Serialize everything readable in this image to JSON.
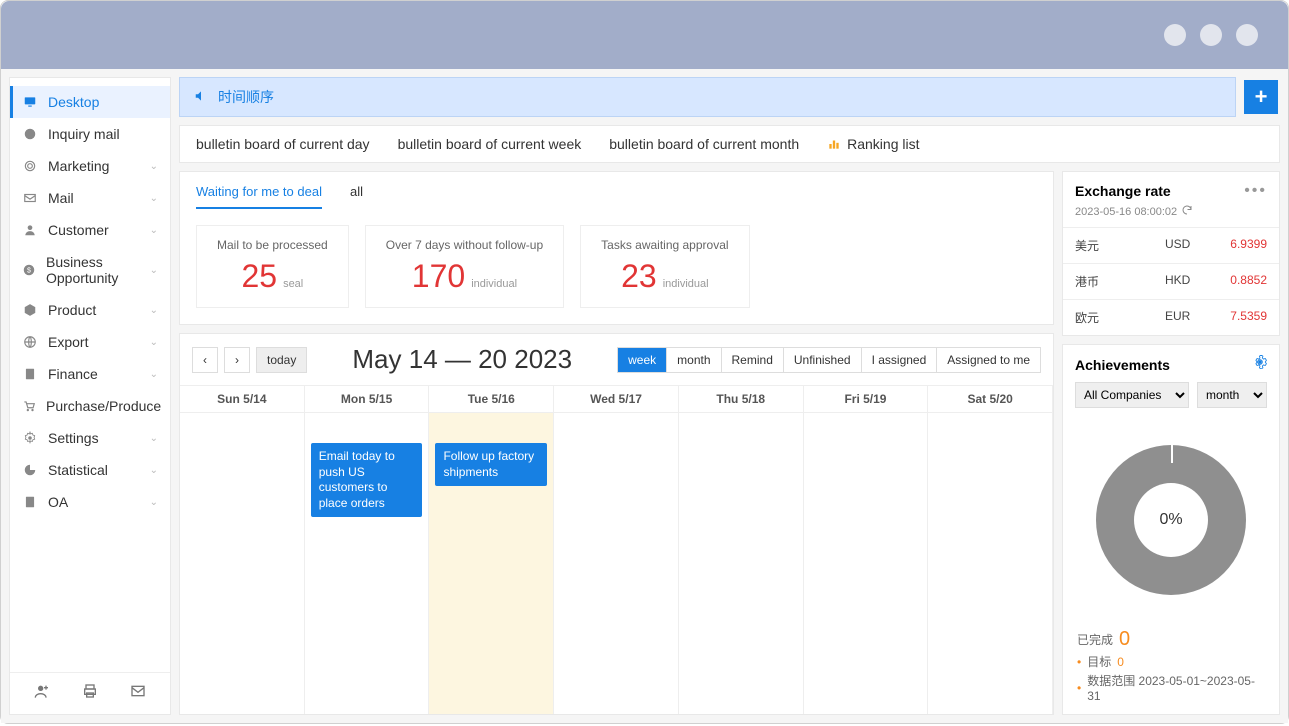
{
  "sidebar": {
    "items": [
      {
        "icon": "desktop",
        "label": "Desktop",
        "expandable": false,
        "active": true
      },
      {
        "icon": "inbox",
        "label": "Inquiry mail",
        "expandable": false
      },
      {
        "icon": "target",
        "label": "Marketing",
        "expandable": true
      },
      {
        "icon": "mail",
        "label": "Mail",
        "expandable": true
      },
      {
        "icon": "user",
        "label": "Customer",
        "expandable": true
      },
      {
        "icon": "biz",
        "label": "Business Opportunity",
        "expandable": true
      },
      {
        "icon": "box",
        "label": "Product",
        "expandable": true
      },
      {
        "icon": "globe",
        "label": "Export",
        "expandable": true
      },
      {
        "icon": "calc",
        "label": "Finance",
        "expandable": true
      },
      {
        "icon": "cart",
        "label": "Purchase/Produce",
        "expandable": false
      },
      {
        "icon": "gear",
        "label": "Settings",
        "expandable": true
      },
      {
        "icon": "chart",
        "label": "Statistical",
        "expandable": true
      },
      {
        "icon": "doc",
        "label": "OA",
        "expandable": true
      }
    ]
  },
  "notice_bar": {
    "text": "时间顺序"
  },
  "bulletins": {
    "items": [
      "bulletin board of current day",
      "bulletin board of current week",
      "bulletin board of current month"
    ],
    "ranking": "Ranking list"
  },
  "task_tabs": {
    "active": "Waiting for me to deal",
    "other": "all"
  },
  "task_cards": [
    {
      "title": "Mail to be processed",
      "num": "25",
      "unit": "seal"
    },
    {
      "title": "Over 7 days without follow-up",
      "num": "170",
      "unit": "individual"
    },
    {
      "title": "Tasks awaiting approval",
      "num": "23",
      "unit": "individual"
    }
  ],
  "calendar": {
    "today": "today",
    "title": "May 14 — 20 2023",
    "views": [
      "week",
      "month",
      "Remind",
      "Unfinished",
      "I assigned",
      "Assigned to me"
    ],
    "active_view": "week",
    "days": [
      "Sun 5/14",
      "Mon 5/15",
      "Tue 5/16",
      "Wed 5/17",
      "Thu 5/18",
      "Fri 5/19",
      "Sat 5/20"
    ],
    "today_index": 2,
    "events": [
      {
        "day": 1,
        "text": "Email today to push US customers to place orders"
      },
      {
        "day": 2,
        "text": "Follow up factory shipments"
      }
    ]
  },
  "exchange": {
    "title": "Exchange rate",
    "timestamp": "2023-05-16 08:00:02",
    "rows": [
      {
        "cn": "美元",
        "code": "USD",
        "rate": "6.9399"
      },
      {
        "cn": "港币",
        "code": "HKD",
        "rate": "0.8852"
      },
      {
        "cn": "欧元",
        "code": "EUR",
        "rate": "7.5359"
      }
    ]
  },
  "achievements": {
    "title": "Achievements",
    "company": "All Companies",
    "period": "month",
    "percent": "0%",
    "completed_label": "已完成",
    "completed_value": "0",
    "target_label": "目标",
    "target_value": "0",
    "range_label": "数据范围 2023-05-01~2023-05-31"
  },
  "chart_data": {
    "type": "pie",
    "title": "Achievements",
    "values": [
      0
    ],
    "categories": [
      "completion"
    ],
    "percent": "0%"
  }
}
